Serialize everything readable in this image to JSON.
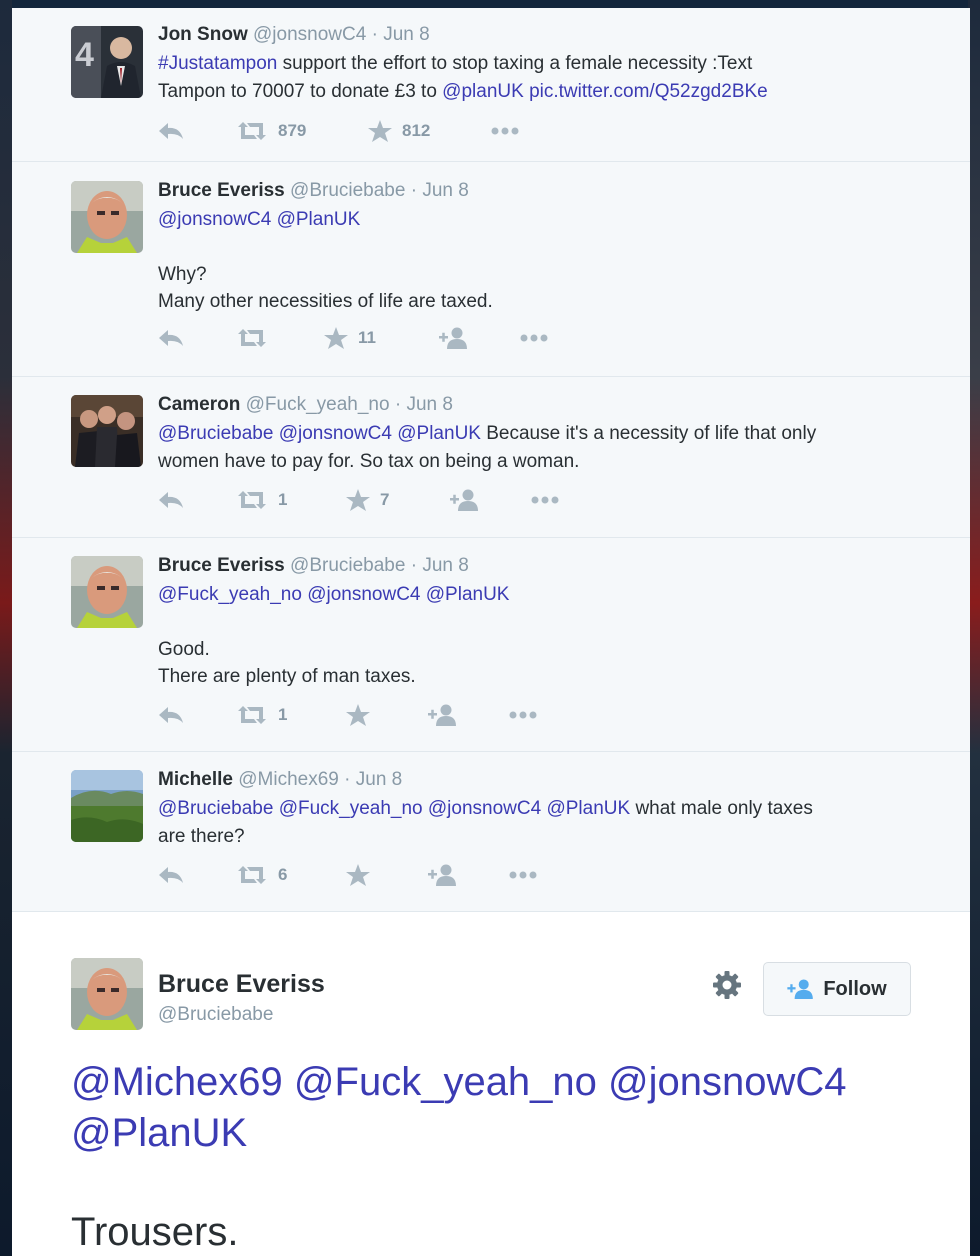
{
  "tweets": [
    {
      "fullname": "Jon Snow",
      "handle": "@jonsnowC4",
      "date": "· Jun 8",
      "line1": [
        {
          "t": "#Justatampon",
          "link": true
        },
        {
          "t": " support the effort to stop taxing a female necessity :Text",
          "link": false
        }
      ],
      "line2": [
        {
          "t": "Tampon to 70007 to donate £3 to ",
          "link": false
        },
        {
          "t": "@planUK",
          "link": true
        },
        {
          "t": " ",
          "link": false
        },
        {
          "t": "pic.twitter.com/Q52zgd2BKe",
          "link": true
        }
      ],
      "retweets": "879",
      "favorites": "812"
    },
    {
      "fullname": "Bruce Everiss",
      "handle": "@Bruciebabe",
      "date": "· Jun 8",
      "mentions": "@jonsnowC4 @PlanUK",
      "body1": "Why?",
      "body2": "Many other necessities of life are taxed.",
      "retweets": "",
      "favorites": "11"
    },
    {
      "fullname": "Cameron",
      "handle": "@Fuck_yeah_no",
      "date": "· Jun 8",
      "mentions": "@Bruciebabe @jonsnowC4 @PlanUK",
      "body1": " Because it's a necessity of life that only",
      "body2": "women have to pay for. So tax on being a woman.",
      "retweets": "1",
      "favorites": "7"
    },
    {
      "fullname": "Bruce Everiss",
      "handle": "@Bruciebabe",
      "date": "· Jun 8",
      "mentions": "@Fuck_yeah_no @jonsnowC4 @PlanUK",
      "body1": "Good.",
      "body2": "There are plenty of man taxes.",
      "retweets": "1",
      "favorites": ""
    },
    {
      "fullname": "Michelle",
      "handle": "@Michex69",
      "date": "· Jun 8",
      "mentions": "@Bruciebabe @Fuck_yeah_no @jonsnowC4 @PlanUK",
      "body1": " what male only taxes",
      "body2": "are there?",
      "retweets": "6",
      "favorites": ""
    }
  ],
  "focused": {
    "fullname": "Bruce Everiss",
    "handle": "@Bruciebabe",
    "follow_label": "Follow",
    "mentions_line1": "@Michex69 @Fuck_yeah_no @jonsnowC4",
    "mentions_line2": "@PlanUK",
    "body": "Trousers."
  },
  "colors": {
    "link": "#3b3bb3",
    "text": "#292f33",
    "muted": "#8899a6"
  }
}
